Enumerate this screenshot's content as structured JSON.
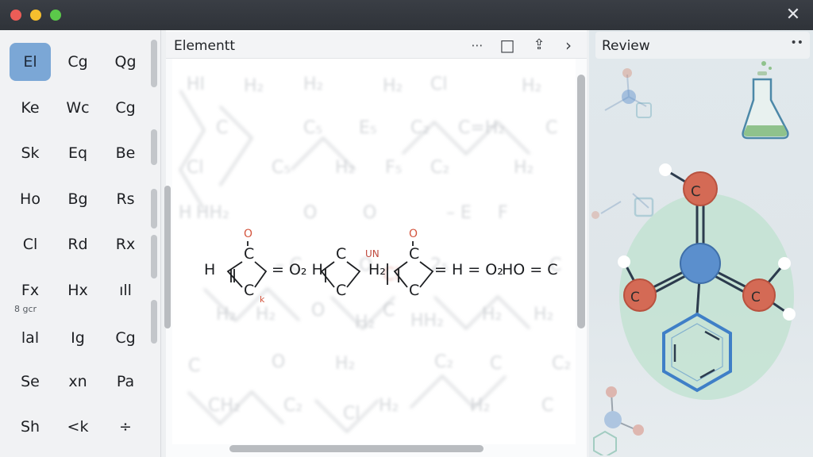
{
  "window": {
    "controls": [
      "close",
      "minimize",
      "maximize"
    ],
    "close_glyph": "✕"
  },
  "elements_panel": {
    "cells": [
      {
        "label": "El",
        "selected": true
      },
      {
        "label": "Cg"
      },
      {
        "label": "Qg"
      },
      {
        "label": "Ke"
      },
      {
        "label": "Wc"
      },
      {
        "label": "Cg"
      },
      {
        "label": "Sk"
      },
      {
        "label": "Eq"
      },
      {
        "label": "Be"
      },
      {
        "label": "Ho"
      },
      {
        "label": "Bg"
      },
      {
        "label": "Rs"
      },
      {
        "label": "Cl"
      },
      {
        "label": "Rd"
      },
      {
        "label": "Rx"
      },
      {
        "label": "Fx"
      },
      {
        "label": "Hx"
      },
      {
        "label": "ıll"
      },
      {
        "label": "lal"
      },
      {
        "label": "Ig"
      },
      {
        "label": "Cg"
      },
      {
        "label": "Se"
      },
      {
        "label": "xn"
      },
      {
        "label": "Pa"
      },
      {
        "label": "Sh"
      },
      {
        "label": "<k"
      },
      {
        "label": "÷"
      }
    ],
    "caption": "8 gcr"
  },
  "editor": {
    "title": "Elementt",
    "toolbar": {
      "more": "⋯",
      "square": "□",
      "share": "⇪",
      "forward": "›"
    },
    "formula": {
      "tokens": [
        "H",
        "C",
        "=",
        "O₂",
        "H",
        "C",
        "H₂",
        "C",
        "= H = O₂",
        "HO = C"
      ],
      "labels_red": [
        "O",
        "O",
        "UN",
        "k"
      ]
    }
  },
  "review": {
    "title": "Review",
    "more": "••",
    "accent": "#3f7fc7",
    "atom_red": "#d46a55",
    "atom_blue": "#5b8fcd"
  }
}
